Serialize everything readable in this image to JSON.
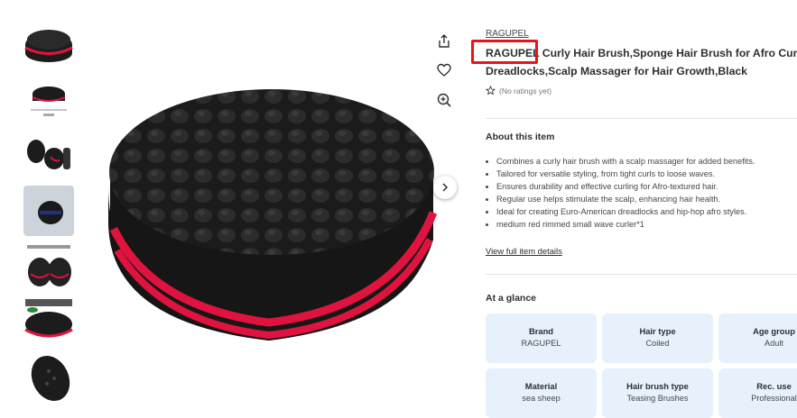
{
  "gallery": {
    "thumbnails": [
      "sponge-top-view",
      "sponge-with-dimensions",
      "sponges-with-brush",
      "sponge-side-view",
      "sponge-packaging",
      "sponge-close-up",
      "sponge-oval-top"
    ],
    "actions": [
      "share-icon",
      "heart-icon",
      "zoom-icon"
    ],
    "next_icon": "chevron-right-icon"
  },
  "product": {
    "brand_link": "RAGUPEL",
    "title_brand": "RAGUPEL",
    "title_line1": " Curly Hair Brush,Sponge Hair Brush for Afro Curls &",
    "title_line2": "Dreadlocks,Scalp Massager for Hair Growth,Black",
    "rating_text": "(No ratings yet)"
  },
  "about": {
    "heading": "About this item",
    "bullets": [
      "Combines a curly hair brush with a scalp massager for added benefits.",
      "Tailored for versatile styling, from tight curls to loose waves.",
      "Ensures durability and effective curling for Afro-textured hair.",
      "Regular use helps stimulate the scalp, enhancing hair health.",
      "Ideal for creating Euro-American dreadlocks and hip-hop afro styles.",
      "medium red rimmed small wave curler*1"
    ],
    "full_details_link": "View full item details"
  },
  "glance": {
    "heading": "At a glance",
    "cards": [
      {
        "key": "Brand",
        "value": "RAGUPEL"
      },
      {
        "key": "Hair type",
        "value": "Coiled"
      },
      {
        "key": "Age group",
        "value": "Adult"
      },
      {
        "key": "Material",
        "value": "sea sheep"
      },
      {
        "key": "Hair brush type",
        "value": "Teasing Brushes"
      },
      {
        "key": "Rec. use",
        "value": "Professional"
      }
    ]
  },
  "colors": {
    "highlight": "#e8141c",
    "card_bg": "#e6f1fc",
    "sponge": "#1c1c1c",
    "stripe": "#e0133f"
  }
}
